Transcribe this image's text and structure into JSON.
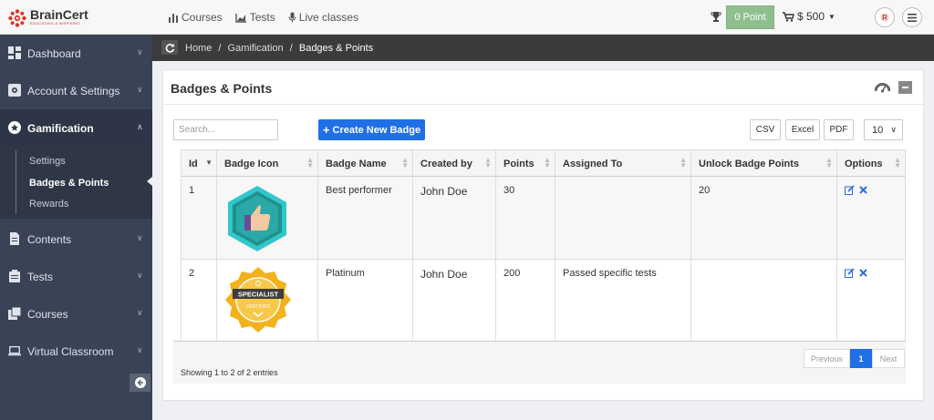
{
  "brand": {
    "name": "BrainCert",
    "tagline": "EDUCATING & INSPIRING"
  },
  "topnav": [
    {
      "label": "Courses",
      "icon": "bar-chart-icon"
    },
    {
      "label": "Tests",
      "icon": "area-chart-icon"
    },
    {
      "label": "Live classes",
      "icon": "microphone-icon"
    }
  ],
  "header": {
    "points": "0 Point",
    "balance": "$ 500"
  },
  "sidebar": {
    "items": [
      {
        "label": "Dashboard"
      },
      {
        "label": "Account & Settings"
      },
      {
        "label": "Gamification"
      },
      {
        "label": "Contents"
      },
      {
        "label": "Tests"
      },
      {
        "label": "Courses"
      },
      {
        "label": "Virtual Classroom"
      }
    ],
    "submenu": [
      {
        "label": "Settings"
      },
      {
        "label": "Badges & Points"
      },
      {
        "label": "Rewards"
      }
    ]
  },
  "breadcrumb": {
    "home": "Home",
    "section": "Gamification",
    "current": "Badges & Points",
    "sep": "/"
  },
  "panel": {
    "title": "Badges & Points"
  },
  "toolbar": {
    "search_placeholder": "Search...",
    "create_label": "Create New Badge",
    "csv": "CSV",
    "excel": "Excel",
    "pdf": "PDF",
    "page_size": "10"
  },
  "table": {
    "columns": [
      "Id",
      "Badge Icon",
      "Badge Name",
      "Created by",
      "Points",
      "Assigned To",
      "Unlock Badge Points",
      "Options"
    ],
    "rows": [
      {
        "id": "1",
        "badge": "thumbs-up-badge",
        "name": "Best performer",
        "created_by": "John Doe",
        "points": "30",
        "assigned_to": "",
        "unlock": "20"
      },
      {
        "id": "2",
        "badge": "specialist-certified-badge",
        "name": "Platinum",
        "created_by": "John Doe",
        "points": "200",
        "assigned_to": "Passed specific tests",
        "unlock": ""
      }
    ]
  },
  "badge_text": {
    "specialist": "SPECIALIST",
    "certified": "CERTIFIED"
  },
  "footer": {
    "showing": "Showing 1 to 2 of 2 entries",
    "previous": "Previous",
    "page": "1",
    "next": "Next"
  },
  "colors": {
    "accent": "#1f6fe5",
    "sidebar": "#3a4256",
    "points_btn": "#8fbf8f",
    "teal": "#31c6c9",
    "gold": "#f2b21b"
  }
}
